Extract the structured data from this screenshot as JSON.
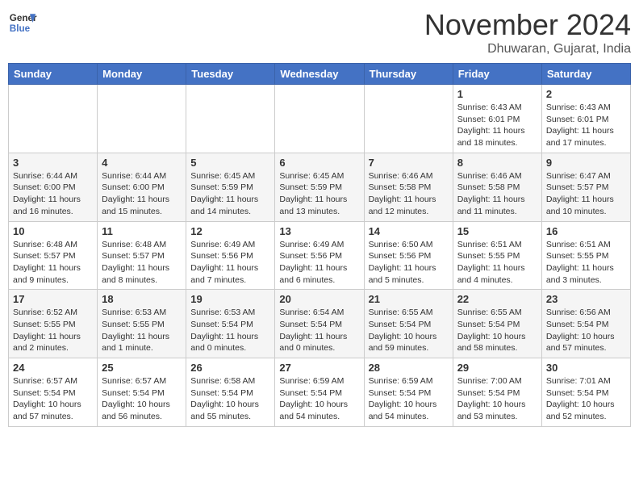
{
  "header": {
    "logo_line1": "General",
    "logo_line2": "Blue",
    "month": "November 2024",
    "location": "Dhuwaran, Gujarat, India"
  },
  "weekdays": [
    "Sunday",
    "Monday",
    "Tuesday",
    "Wednesday",
    "Thursday",
    "Friday",
    "Saturday"
  ],
  "weeks": [
    [
      {
        "day": "",
        "content": ""
      },
      {
        "day": "",
        "content": ""
      },
      {
        "day": "",
        "content": ""
      },
      {
        "day": "",
        "content": ""
      },
      {
        "day": "",
        "content": ""
      },
      {
        "day": "1",
        "content": "Sunrise: 6:43 AM\nSunset: 6:01 PM\nDaylight: 11 hours and 18 minutes."
      },
      {
        "day": "2",
        "content": "Sunrise: 6:43 AM\nSunset: 6:01 PM\nDaylight: 11 hours and 17 minutes."
      }
    ],
    [
      {
        "day": "3",
        "content": "Sunrise: 6:44 AM\nSunset: 6:00 PM\nDaylight: 11 hours and 16 minutes."
      },
      {
        "day": "4",
        "content": "Sunrise: 6:44 AM\nSunset: 6:00 PM\nDaylight: 11 hours and 15 minutes."
      },
      {
        "day": "5",
        "content": "Sunrise: 6:45 AM\nSunset: 5:59 PM\nDaylight: 11 hours and 14 minutes."
      },
      {
        "day": "6",
        "content": "Sunrise: 6:45 AM\nSunset: 5:59 PM\nDaylight: 11 hours and 13 minutes."
      },
      {
        "day": "7",
        "content": "Sunrise: 6:46 AM\nSunset: 5:58 PM\nDaylight: 11 hours and 12 minutes."
      },
      {
        "day": "8",
        "content": "Sunrise: 6:46 AM\nSunset: 5:58 PM\nDaylight: 11 hours and 11 minutes."
      },
      {
        "day": "9",
        "content": "Sunrise: 6:47 AM\nSunset: 5:57 PM\nDaylight: 11 hours and 10 minutes."
      }
    ],
    [
      {
        "day": "10",
        "content": "Sunrise: 6:48 AM\nSunset: 5:57 PM\nDaylight: 11 hours and 9 minutes."
      },
      {
        "day": "11",
        "content": "Sunrise: 6:48 AM\nSunset: 5:57 PM\nDaylight: 11 hours and 8 minutes."
      },
      {
        "day": "12",
        "content": "Sunrise: 6:49 AM\nSunset: 5:56 PM\nDaylight: 11 hours and 7 minutes."
      },
      {
        "day": "13",
        "content": "Sunrise: 6:49 AM\nSunset: 5:56 PM\nDaylight: 11 hours and 6 minutes."
      },
      {
        "day": "14",
        "content": "Sunrise: 6:50 AM\nSunset: 5:56 PM\nDaylight: 11 hours and 5 minutes."
      },
      {
        "day": "15",
        "content": "Sunrise: 6:51 AM\nSunset: 5:55 PM\nDaylight: 11 hours and 4 minutes."
      },
      {
        "day": "16",
        "content": "Sunrise: 6:51 AM\nSunset: 5:55 PM\nDaylight: 11 hours and 3 minutes."
      }
    ],
    [
      {
        "day": "17",
        "content": "Sunrise: 6:52 AM\nSunset: 5:55 PM\nDaylight: 11 hours and 2 minutes."
      },
      {
        "day": "18",
        "content": "Sunrise: 6:53 AM\nSunset: 5:55 PM\nDaylight: 11 hours and 1 minute."
      },
      {
        "day": "19",
        "content": "Sunrise: 6:53 AM\nSunset: 5:54 PM\nDaylight: 11 hours and 0 minutes."
      },
      {
        "day": "20",
        "content": "Sunrise: 6:54 AM\nSunset: 5:54 PM\nDaylight: 11 hours and 0 minutes."
      },
      {
        "day": "21",
        "content": "Sunrise: 6:55 AM\nSunset: 5:54 PM\nDaylight: 10 hours and 59 minutes."
      },
      {
        "day": "22",
        "content": "Sunrise: 6:55 AM\nSunset: 5:54 PM\nDaylight: 10 hours and 58 minutes."
      },
      {
        "day": "23",
        "content": "Sunrise: 6:56 AM\nSunset: 5:54 PM\nDaylight: 10 hours and 57 minutes."
      }
    ],
    [
      {
        "day": "24",
        "content": "Sunrise: 6:57 AM\nSunset: 5:54 PM\nDaylight: 10 hours and 57 minutes."
      },
      {
        "day": "25",
        "content": "Sunrise: 6:57 AM\nSunset: 5:54 PM\nDaylight: 10 hours and 56 minutes."
      },
      {
        "day": "26",
        "content": "Sunrise: 6:58 AM\nSunset: 5:54 PM\nDaylight: 10 hours and 55 minutes."
      },
      {
        "day": "27",
        "content": "Sunrise: 6:59 AM\nSunset: 5:54 PM\nDaylight: 10 hours and 54 minutes."
      },
      {
        "day": "28",
        "content": "Sunrise: 6:59 AM\nSunset: 5:54 PM\nDaylight: 10 hours and 54 minutes."
      },
      {
        "day": "29",
        "content": "Sunrise: 7:00 AM\nSunset: 5:54 PM\nDaylight: 10 hours and 53 minutes."
      },
      {
        "day": "30",
        "content": "Sunrise: 7:01 AM\nSunset: 5:54 PM\nDaylight: 10 hours and 52 minutes."
      }
    ]
  ]
}
